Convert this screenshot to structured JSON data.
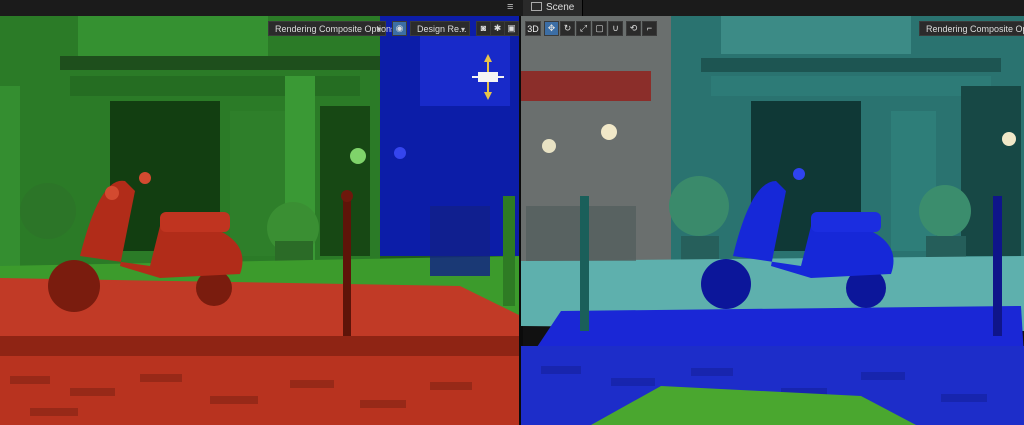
{
  "window": {
    "menu_icon": "hamburger-icon",
    "tab_label": "Scene"
  },
  "left_viewport": {
    "composite_dropdown": "Rendering Composite Options",
    "design_dropdown": "Design Re..."
  },
  "right_viewport": {
    "mode_3d": "3D",
    "composite_dropdown": "Rendering Composite Options"
  },
  "colors": {
    "red_pass": "#c13a26",
    "green_pass": "#2f8a2c",
    "blue_pass": "#1e2dd0",
    "teal_pass": "#3b8a86"
  }
}
